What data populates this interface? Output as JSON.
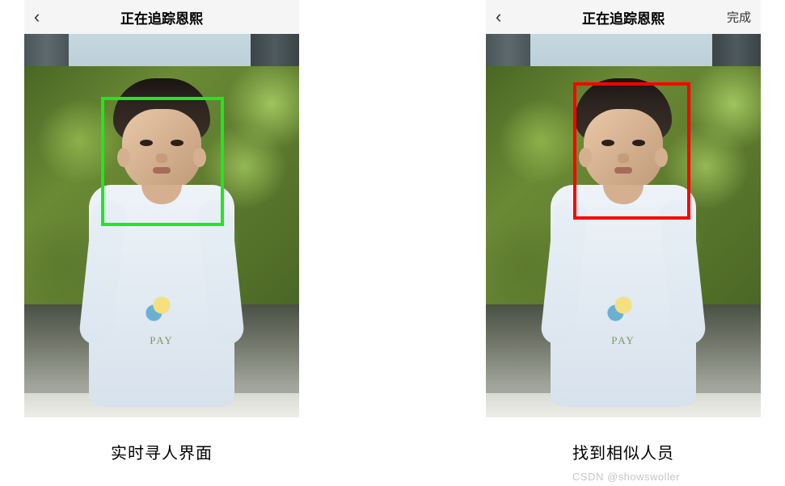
{
  "screens": {
    "left": {
      "back_icon": "‹",
      "title": "正在追踪恩熙",
      "face_box_color": "#1ee81e",
      "caption": "实时寻人界面"
    },
    "right": {
      "back_icon": "‹",
      "title": "正在追踪恩熙",
      "done_label": "完成",
      "face_box_color": "#ff0000",
      "caption": "找到相似人员"
    }
  },
  "shirt_text": "PAY",
  "watermark": "CSDN @showswoller"
}
